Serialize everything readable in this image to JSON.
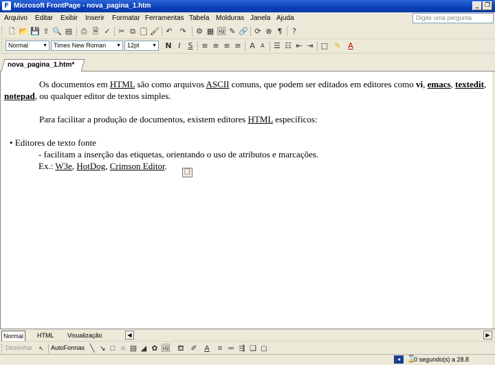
{
  "window": {
    "title": "Microsoft FrontPage - nova_pagina_1.htm",
    "minimize": "_",
    "restore": "❐"
  },
  "menu": [
    "Arquivo",
    "Editar",
    "Exibir",
    "Inserir",
    "Formatar",
    "Ferramentas",
    "Tabela",
    "Molduras",
    "Janela",
    "Ajuda"
  ],
  "ask_placeholder": "Digite uma pergunta",
  "format_bar": {
    "style": "Normal",
    "font": "Times New Roman",
    "size": "12pt"
  },
  "doc_tab": "nova_pagina_1.htm*",
  "document": {
    "p1_a": "Os documentos em ",
    "p1_html": "HTML",
    "p1_b": " são como arquivos ",
    "p1_ascii": "ASCII",
    "p1_c": " comuns, que podem ser editados em editores como ",
    "p1_vi": "vi",
    "p1_d": ", ",
    "p1_emacs": "emacs",
    "p1_e": ", ",
    "p1_textedit": "textedit",
    "p1_f": ", ",
    "p1_notepad": "notepad",
    "p1_g": ", ou qualquer editor de textos simples.",
    "p2_a": "Para facilitar a produção de documentos, existem editores ",
    "p2_html": "HTML",
    "p2_b": " específicos:",
    "bullet": "Editores de texto fonte",
    "line2": "- facilitam a inserção das etiquetas, orientando o uso de atributos e marcações.",
    "ex_a": "Ex.:  ",
    "ex_w3e": "W3e",
    "ex_sep1": ", ",
    "ex_hotdog": "HotDog",
    "ex_sep2": ", ",
    "ex_crimson": "Crimson Editor",
    "ex_end": "."
  },
  "view_tabs": [
    "Normal",
    "HTML",
    "Visualização"
  ],
  "draw_bar": {
    "draw": "Desenhar",
    "autoshapes": "AutoFormas"
  },
  "status": "0 segundo(s) a 28.8"
}
